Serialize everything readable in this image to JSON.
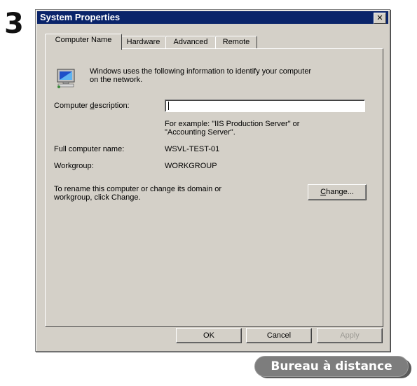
{
  "step": "3",
  "window": {
    "title": "System Properties",
    "close_label": "✕"
  },
  "tabs": [
    {
      "label": "Computer Name"
    },
    {
      "label": "Hardware"
    },
    {
      "label": "Advanced"
    },
    {
      "label": "Remote"
    }
  ],
  "computer_name": {
    "intro": "Windows uses the following information to identify your computer on the network.",
    "intro_line1": "Windows uses the following information to identify your computer",
    "intro_line2": "on the network.",
    "description_label_pre": "Computer ",
    "description_label_u": "d",
    "description_label_post": "escription:",
    "description_value": "",
    "example_line1": "For example: \"IIS Production Server\" or",
    "example_line2": "\"Accounting Server\".",
    "full_name_label": "Full computer name:",
    "full_name_value": "WSVL-TEST-01",
    "workgroup_label": "Workgroup:",
    "workgroup_value": "WORKGROUP",
    "rename_line1": "To rename this computer or change its domain or",
    "rename_line2": "workgroup, click Change.",
    "change_button_u": "C",
    "change_button_rest": "hange..."
  },
  "footer": {
    "ok": "OK",
    "cancel": "Cancel",
    "apply": "Apply"
  },
  "badge": "Bureau à distance",
  "icons": [
    "computer-network-icon",
    "close-icon"
  ]
}
